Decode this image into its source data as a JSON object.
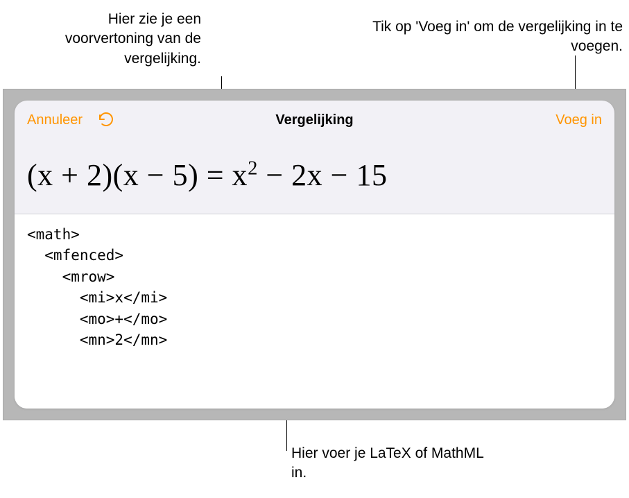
{
  "callouts": {
    "preview": "Hier zie je een voorvertoning van de vergelijking.",
    "insert": "Tik op 'Voeg in' om de vergelijking in te voegen.",
    "editor": "Hier voer je LaTeX of MathML in."
  },
  "toolbar": {
    "cancel_label": "Annuleer",
    "title": "Vergelijking",
    "insert_label": "Voeg in"
  },
  "preview_html": "(x + 2)(x − 5) = x<sup>2</sup> − 2x − 15",
  "editor_text": "<math>\n  <mfenced>\n    <mrow>\n      <mi>x</mi>\n      <mo>+</mo>\n      <mn>2</mn>",
  "colors": {
    "accent": "#ff9500",
    "panel_bg": "#f2f1f6",
    "frame_bg": "#b7b7b7"
  }
}
